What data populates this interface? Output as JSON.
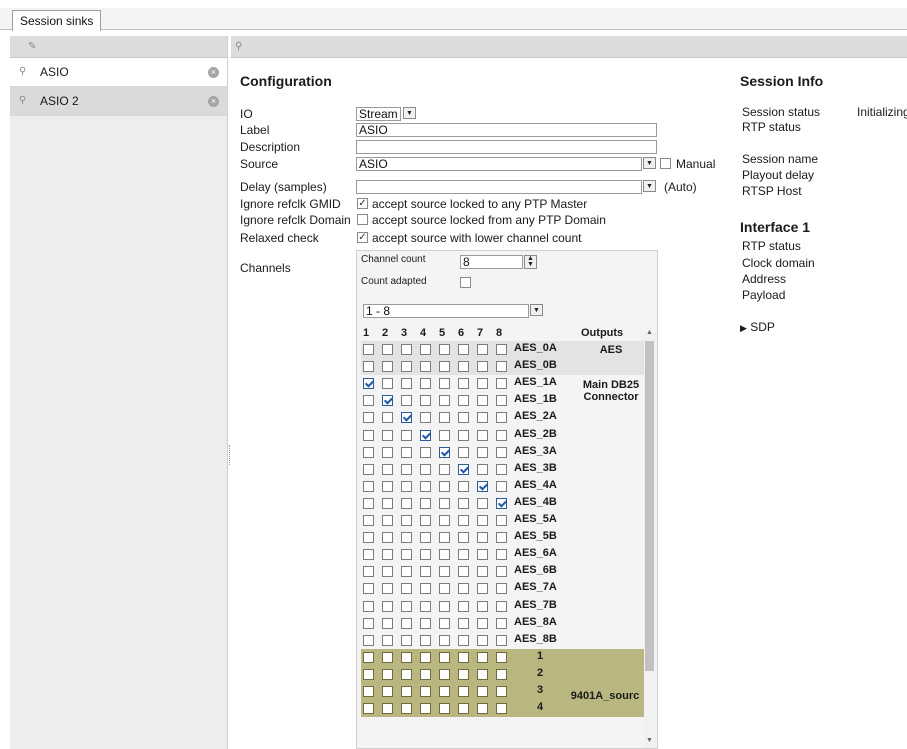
{
  "tabs": {
    "session_sinks": "Session sinks"
  },
  "left": {
    "items": [
      {
        "label": "ASIO",
        "selected": true
      },
      {
        "label": "ASIO 2",
        "selected": false
      }
    ]
  },
  "config": {
    "title": "Configuration",
    "io_label": "IO",
    "io_value": "Stream",
    "label_label": "Label",
    "label_value": "ASIO",
    "description_label": "Description",
    "description_value": "",
    "source_label": "Source",
    "source_value": "ASIO",
    "manual_label": "Manual",
    "delay_label": "Delay (samples)",
    "delay_value": "",
    "auto_label": "(Auto)",
    "ignore_gmid_label": "Ignore refclk GMID",
    "ignore_gmid_text": "accept source locked to any PTP Master",
    "ignore_domain_label": "Ignore refclk Domain",
    "ignore_domain_text": "accept source locked from any PTP Domain",
    "relaxed_label": "Relaxed check",
    "relaxed_text": "accept source with lower channel count",
    "channels_label": "Channels"
  },
  "channels": {
    "count_label": "Channel count",
    "count_value": "8",
    "adapted_label": "Count adapted",
    "range_value": "1 - 8",
    "headers": [
      "1",
      "2",
      "3",
      "4",
      "5",
      "6",
      "7",
      "8"
    ],
    "outputs_header": "Outputs",
    "aes_group": "AES",
    "main_group_line1": "Main DB25",
    "main_group_line2": "Connector",
    "source_group": "9401A_sourc",
    "rows": [
      {
        "name": "AES_0A",
        "checked": -1
      },
      {
        "name": "AES_0B",
        "checked": -1
      },
      {
        "name": "AES_1A",
        "checked": 0
      },
      {
        "name": "AES_1B",
        "checked": 1
      },
      {
        "name": "AES_2A",
        "checked": 2
      },
      {
        "name": "AES_2B",
        "checked": 3
      },
      {
        "name": "AES_3A",
        "checked": 4
      },
      {
        "name": "AES_3B",
        "checked": 5
      },
      {
        "name": "AES_4A",
        "checked": 6
      },
      {
        "name": "AES_4B",
        "checked": 7
      },
      {
        "name": "AES_5A",
        "checked": -1
      },
      {
        "name": "AES_5B",
        "checked": -1
      },
      {
        "name": "AES_6A",
        "checked": -1
      },
      {
        "name": "AES_6B",
        "checked": -1
      },
      {
        "name": "AES_7A",
        "checked": -1
      },
      {
        "name": "AES_7B",
        "checked": -1
      },
      {
        "name": "AES_8A",
        "checked": -1
      },
      {
        "name": "AES_8B",
        "checked": -1
      },
      {
        "name": "1",
        "checked": -1
      },
      {
        "name": "2",
        "checked": -1
      },
      {
        "name": "3",
        "checked": -1
      },
      {
        "name": "4",
        "checked": -1
      }
    ]
  },
  "session_info": {
    "title": "Session Info",
    "session_status_label": "Session status",
    "session_status_value": "Initializing",
    "rtp_status_label": "RTP status",
    "session_name_label": "Session name",
    "playout_delay_label": "Playout delay",
    "rtsp_host_label": "RTSP Host",
    "interface_title": "Interface 1",
    "if_rtp_status_label": "RTP status",
    "clock_domain_label": "Clock domain",
    "address_label": "Address",
    "payload_label": "Payload",
    "sdp_label": "SDP"
  },
  "colors": {
    "olive": "#b9b77f",
    "check": "#2459a8"
  }
}
